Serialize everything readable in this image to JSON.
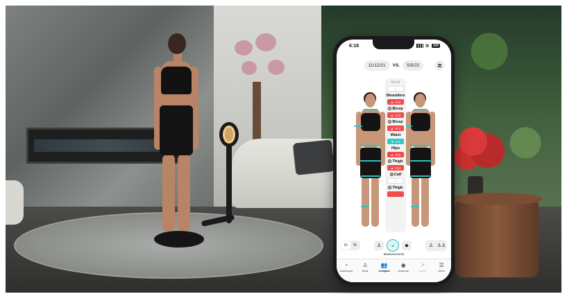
{
  "status": {
    "time": "6:18",
    "battery": "100"
  },
  "compare": {
    "date_a": "11/12/21",
    "vs": "VS.",
    "date_b": "5/5/22"
  },
  "measurements": [
    {
      "label": "Neck",
      "muted": true,
      "info": false,
      "change": "–",
      "dir": "neutral"
    },
    {
      "label": "Shoulders",
      "muted": false,
      "info": false,
      "change": "▲ +0.2",
      "dir": "up"
    },
    {
      "label": "Bicep",
      "muted": false,
      "info": true,
      "change": "▲ +0.3",
      "dir": "up"
    },
    {
      "label": "Bicep",
      "muted": false,
      "info": true,
      "change": "▲ +0.1",
      "dir": "up"
    },
    {
      "label": "Waist",
      "muted": false,
      "info": false,
      "change": "▼ -2.4",
      "dir": "down"
    },
    {
      "label": "Hips",
      "muted": false,
      "info": false,
      "change": "▲ +0.5",
      "dir": "up"
    },
    {
      "label": "Thigh",
      "muted": false,
      "info": true,
      "change": "▲ +0.4",
      "dir": "up"
    },
    {
      "label": "Calf",
      "muted": false,
      "info": true,
      "change": "–",
      "dir": "neutral"
    },
    {
      "label": "Thigh",
      "muted": false,
      "info": true,
      "change": "",
      "dir": "up"
    }
  ],
  "controls": {
    "units": [
      {
        "label": "in",
        "active": true
      },
      {
        "label": "%",
        "active": false
      }
    ],
    "caption": "Measurements"
  },
  "tabs": [
    {
      "label": "Dashboard",
      "icon": "gauge-icon",
      "glyph": "◔",
      "state": "normal"
    },
    {
      "label": "Body",
      "icon": "person-icon",
      "glyph": "♙",
      "state": "normal"
    },
    {
      "label": "Compare",
      "icon": "compare-people-icon",
      "glyph": "👥",
      "state": "active"
    },
    {
      "label": "Heatmap",
      "icon": "heatmap-icon",
      "glyph": "◉",
      "state": "normal"
    },
    {
      "label": "Graph",
      "icon": "graph-icon",
      "glyph": "↗",
      "state": "dim"
    },
    {
      "label": "Menu",
      "icon": "menu-icon",
      "glyph": "☰",
      "state": "normal"
    }
  ],
  "colors": {
    "increase": "#ef4c4c",
    "decrease": "#2fc9c6",
    "accent": "#2fbfbd"
  }
}
